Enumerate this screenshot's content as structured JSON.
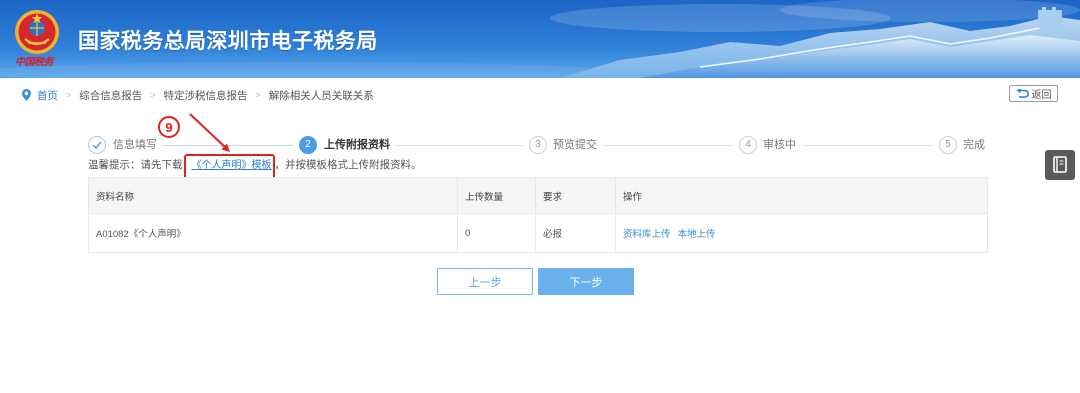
{
  "header": {
    "title": "国家税务总局深圳市电子税务局",
    "logo_text": "中国税务",
    "logo_icon": "tax-emblem-icon"
  },
  "breadcrumb": {
    "icon": "location-pin-icon",
    "separator": ">",
    "items": [
      "首页",
      "综合信息报告",
      "特定涉税信息报告",
      "解除相关人员关联关系"
    ]
  },
  "back_button": {
    "label": "返回",
    "icon": "back-arrow-icon"
  },
  "side_tool": {
    "icon": "book-icon"
  },
  "steps": [
    {
      "label": "信息填写",
      "completed": true,
      "icon": "check-icon"
    },
    {
      "number": "2",
      "label": "上传附报资料",
      "active": true
    },
    {
      "number": "3",
      "label": "预览提交"
    },
    {
      "number": "4",
      "label": "审核中"
    },
    {
      "number": "5",
      "label": "完成"
    }
  ],
  "tip": {
    "prefix": "温馨提示：请先下载",
    "link": "《个人声明》模板",
    "suffix": "，并按模板格式上传附报资料。"
  },
  "table": {
    "columns": [
      "资料名称",
      "上传数量",
      "要求",
      "操作"
    ],
    "rows": [
      {
        "name": "A01082《个人声明》",
        "count": "0",
        "requirement": "必报",
        "actions": [
          "资料库上传",
          "本地上传"
        ]
      }
    ]
  },
  "buttons": {
    "prev": "上一步",
    "next": "下一步"
  },
  "annotation": {
    "number": "9",
    "icon": "arrow-icon"
  },
  "colors": {
    "header_top": "#1c64c6",
    "header_bottom": "#5aa6ea",
    "accent": "#4a9de2",
    "link": "#2a7ed3",
    "next_button": "#6ab1ec",
    "annotation": "#e0231b"
  }
}
